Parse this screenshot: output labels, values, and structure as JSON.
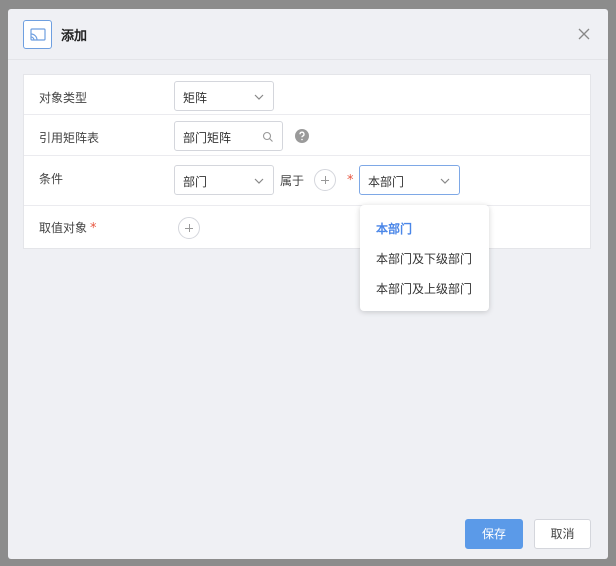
{
  "dialog": {
    "title": "添加",
    "close_icon": "close-icon"
  },
  "form": {
    "object_type": {
      "label": "对象类型",
      "value": "矩阵"
    },
    "matrix_ref": {
      "label": "引用矩阵表",
      "value": "部门矩阵",
      "search_icon": "search-icon",
      "help_icon": "help-icon"
    },
    "condition": {
      "label": "条件",
      "field_value": "部门",
      "operator": "属于",
      "required_mark": "*",
      "scope_value": "本部门"
    },
    "value_object": {
      "label": "取值对象",
      "required_mark": "*"
    }
  },
  "dropdown": {
    "options": [
      {
        "label": "本部门",
        "selected": true
      },
      {
        "label": "本部门及下级部门",
        "selected": false
      },
      {
        "label": "本部门及上级部门",
        "selected": false
      }
    ]
  },
  "footer": {
    "save_label": "保存",
    "cancel_label": "取消"
  },
  "colors": {
    "accent": "#5b9ae8",
    "selected_option": "#4a86e8",
    "required": "#e8553f"
  }
}
